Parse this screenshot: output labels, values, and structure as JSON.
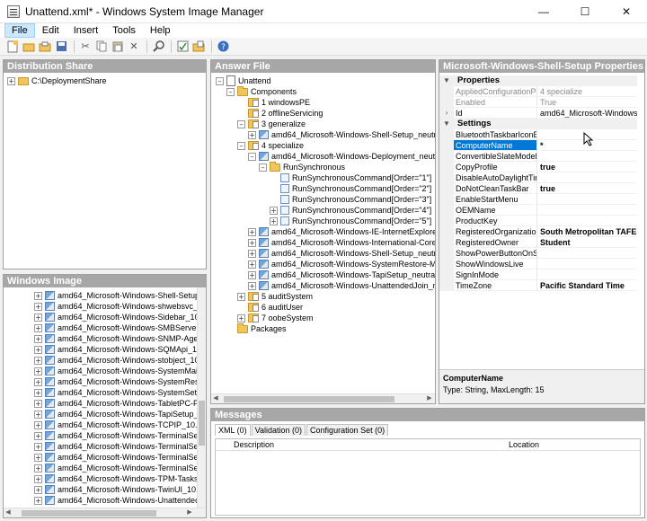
{
  "window": {
    "title": "Unattend.xml* - Windows System Image Manager"
  },
  "menu": [
    "File",
    "Edit",
    "Insert",
    "Tools",
    "Help"
  ],
  "toolbar_icons": [
    "new-icon",
    "open-icon",
    "open-folder-icon",
    "save-icon",
    "cut-icon",
    "copy-icon",
    "paste-icon",
    "delete-icon",
    "find-icon",
    "validate-icon",
    "create-config-icon",
    "help-icon"
  ],
  "distribution": {
    "header": "Distribution Share",
    "root": "C:\\DeploymentShare"
  },
  "windows_image": {
    "header": "Windows Image",
    "items": [
      "amd64_Microsoft-Windows-Shell-Setup_1",
      "amd64_Microsoft-Windows-shwebsvc_10.",
      "amd64_Microsoft-Windows-Sidebar_10.0",
      "amd64_Microsoft-Windows-SMBServer_1",
      "amd64_Microsoft-Windows-SNMP-Agent-",
      "amd64_Microsoft-Windows-SQMApi_10.0",
      "amd64_Microsoft-Windows-stobject_10.0",
      "amd64_Microsoft-Windows-SystemMainte",
      "amd64_Microsoft-Windows-SystemRestor",
      "amd64_Microsoft-Windows-SystemSetting",
      "amd64_Microsoft-Windows-TabletPC-Plat",
      "amd64_Microsoft-Windows-TapiSetup_10",
      "amd64_Microsoft-Windows-TCPIP_10.0.1",
      "amd64_Microsoft-Windows-TerminalServi",
      "amd64_Microsoft-Windows-TerminalServi",
      "amd64_Microsoft-Windows-TerminalServi",
      "amd64_Microsoft-Windows-TerminalServi",
      "amd64_Microsoft-Windows-TPM-Tasks_1",
      "amd64_Microsoft-Windows-TwinUI_10.0.",
      "amd64_Microsoft-Windows-UnattendedJo"
    ]
  },
  "answer_file": {
    "header": "Answer File",
    "root": "Unattend",
    "components": "Components",
    "passes": {
      "p1": "1 windowsPE",
      "p2": "2 offlineServicing",
      "p3": "3 generalize",
      "p3_child": "amd64_Microsoft-Windows-Shell-Setup_neutral",
      "p4": "4 specialize",
      "p4_deploy": "amd64_Microsoft-Windows-Deployment_neutral",
      "run_sync": "RunSynchronous",
      "cmd1": "RunSynchronousCommand[Order=\"1\"]",
      "cmd2": "RunSynchronousCommand[Order=\"2\"]",
      "cmd3": "RunSynchronousCommand[Order=\"3\"]",
      "cmd4": "RunSynchronousCommand[Order=\"4\"]",
      "cmd5": "RunSynchronousCommand[Order=\"5\"]",
      "p4_ie": "amd64_Microsoft-Windows-IE-InternetExplorer_n",
      "p4_intl": "amd64_Microsoft-Windows-International-Core_neu",
      "p4_shell": "amd64_Microsoft-Windows-Shell-Setup_neutral",
      "p4_restore": "amd64_Microsoft-Windows-SystemRestore-Main_",
      "p4_tapi": "amd64_Microsoft-Windows-TapiSetup_neutral",
      "p4_join": "amd64_Microsoft-Windows-UnattendedJoin_neut",
      "p5": "5 auditSystem",
      "p6": "6 auditUser",
      "p7": "7 oobeSystem"
    },
    "packages": "Packages"
  },
  "properties": {
    "header": "Microsoft-Windows-Shell-Setup Properties",
    "cat_properties": "Properties",
    "applied_name": "AppliedConfigurationPas",
    "applied_value": "4 specialize",
    "enabled_name": "Enabled",
    "enabled_value": "True",
    "id_name": "Id",
    "id_value": "amd64_Microsoft-Windows-Shel",
    "cat_settings": "Settings",
    "rows": [
      {
        "name": "BluetoothTaskbarIconEn",
        "value": ""
      },
      {
        "name": "ComputerName",
        "value": "*"
      },
      {
        "name": "ConvertibleSlateModePr",
        "value": ""
      },
      {
        "name": "CopyProfile",
        "value": "true"
      },
      {
        "name": "DisableAutoDaylightTim",
        "value": ""
      },
      {
        "name": "DoNotCleanTaskBar",
        "value": "true"
      },
      {
        "name": "EnableStartMenu",
        "value": ""
      },
      {
        "name": "OEMName",
        "value": ""
      },
      {
        "name": "ProductKey",
        "value": ""
      },
      {
        "name": "RegisteredOrganization",
        "value": "South Metropolitan TAFE"
      },
      {
        "name": "RegisteredOwner",
        "value": "Student"
      },
      {
        "name": "ShowPowerButtonOnSt",
        "value": ""
      },
      {
        "name": "ShowWindowsLive",
        "value": ""
      },
      {
        "name": "SignInMode",
        "value": ""
      },
      {
        "name": "TimeZone",
        "value": "Pacific Standard Time"
      }
    ],
    "desc_title": "ComputerName",
    "desc_text": "Type: String, MaxLength: 15"
  },
  "messages": {
    "header": "Messages",
    "tabs": [
      "XML (0)",
      "Validation (0)",
      "Configuration Set (0)"
    ],
    "col_description": "Description",
    "col_location": "Location"
  }
}
